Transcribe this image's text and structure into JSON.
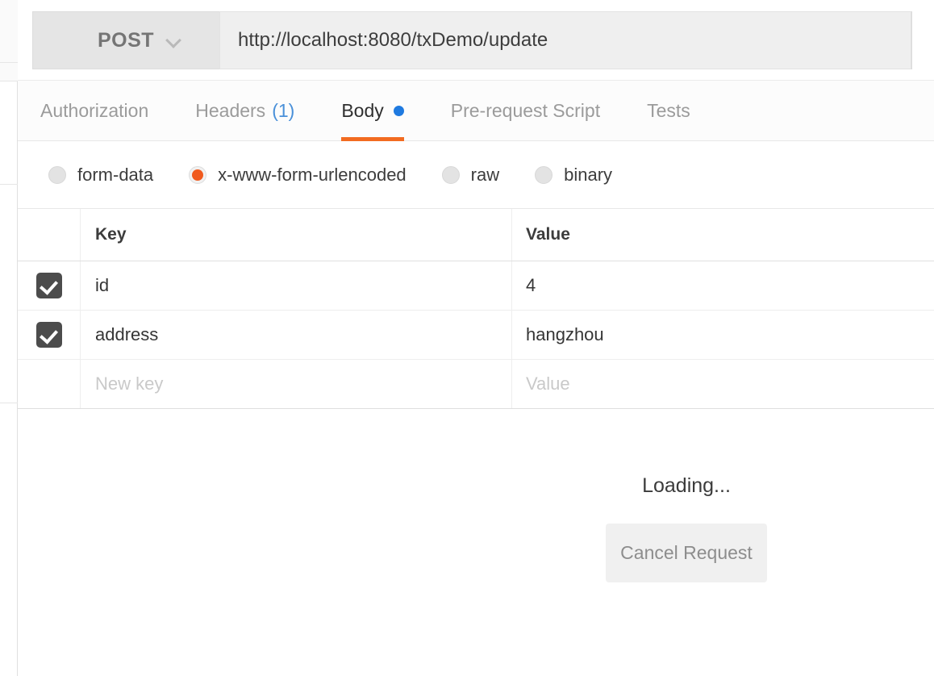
{
  "request_bar": {
    "method": "POST",
    "method_chevron": "chevron-down-icon",
    "url": "http://localhost:8080/txDemo/update"
  },
  "tabs": [
    {
      "label": "Authorization",
      "active": false,
      "count": "",
      "dot": false
    },
    {
      "label": "Headers",
      "active": false,
      "count": "(1)",
      "dot": false
    },
    {
      "label": "Body",
      "active": true,
      "count": "",
      "dot": true
    },
    {
      "label": "Pre-request Script",
      "active": false,
      "count": "",
      "dot": false
    },
    {
      "label": "Tests",
      "active": false,
      "count": "",
      "dot": false
    }
  ],
  "body_types": {
    "selected": "x-www-form-urlencoded",
    "options": [
      {
        "label": "form-data",
        "selected": false
      },
      {
        "label": "x-www-form-urlencoded",
        "selected": true
      },
      {
        "label": "raw",
        "selected": false
      },
      {
        "label": "binary",
        "selected": false
      }
    ]
  },
  "params_table": {
    "headers": {
      "key": "Key",
      "value": "Value"
    },
    "rows": [
      {
        "checked": true,
        "key": "id",
        "value": "4"
      },
      {
        "checked": true,
        "key": "address",
        "value": "hangzhou"
      }
    ],
    "new_row": {
      "key_placeholder": "New key",
      "value_placeholder": "Value"
    }
  },
  "response": {
    "loading_text": "Loading...",
    "cancel_label": "Cancel Request"
  },
  "colors": {
    "accent_orange": "#f26b21",
    "radio_orange": "#f05a1e",
    "tab_dot_blue": "#1f7ae0",
    "count_blue": "#4a90d9",
    "checkbox_dark": "#4c4c4c"
  }
}
